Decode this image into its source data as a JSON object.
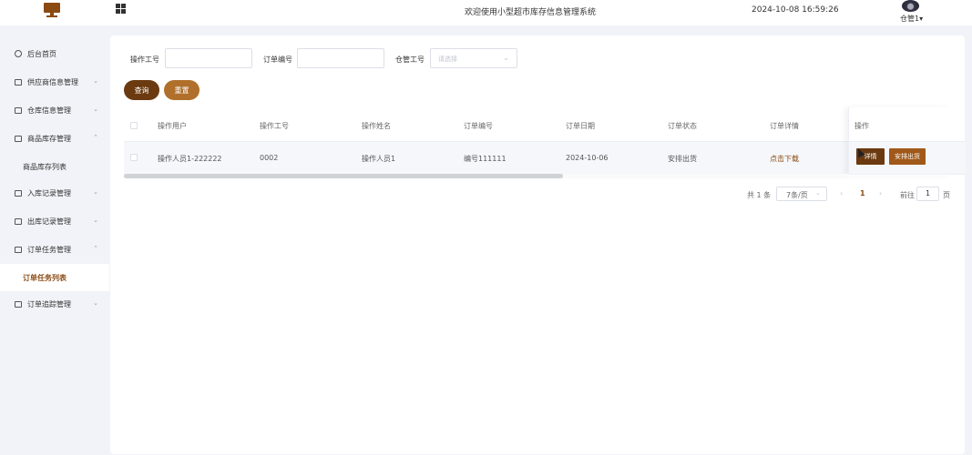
{
  "header": {
    "system_title": "欢迎使用小型超市库存信息管理系统",
    "datetime": "2024-10-08 16:59:26",
    "user_name": "仓管1",
    "user_caret": "▾"
  },
  "sidebar": {
    "items": [
      {
        "label": "后台首页",
        "icon": "clock-icon"
      },
      {
        "label": "供应商信息管理",
        "icon": "menu-icon",
        "arrow": "⌄"
      },
      {
        "label": "仓库信息管理",
        "icon": "menu-icon",
        "arrow": "⌄"
      },
      {
        "label": "商品库存管理",
        "icon": "menu-icon",
        "arrow": "⌃"
      },
      {
        "label": "商品库存列表"
      },
      {
        "label": "入库记录管理",
        "icon": "menu-icon",
        "arrow": "⌄"
      },
      {
        "label": "出库记录管理",
        "icon": "menu-icon",
        "arrow": "⌄"
      },
      {
        "label": "订单任务管理",
        "icon": "menu-icon",
        "arrow": "⌃"
      },
      {
        "label": "订单任务列表",
        "active": true
      },
      {
        "label": "订单追踪管理",
        "icon": "menu-icon",
        "arrow": "⌄"
      }
    ]
  },
  "filters": {
    "operator_id_label": "操作工号",
    "order_no_label": "订单编号",
    "warehouse_id_label": "仓管工号",
    "warehouse_placeholder": "请选择",
    "select_arrow": "⌄",
    "query_label": "查询",
    "reset_label": "重置"
  },
  "table": {
    "columns": [
      "操作用户",
      "操作工号",
      "操作姓名",
      "订单编号",
      "订单日期",
      "订单状态",
      "订单详情",
      "操作"
    ],
    "rows": [
      {
        "user": "操作人员1-222222",
        "op_id": "0002",
        "op_name": "操作人员1",
        "order_no": "编号111111",
        "order_date": "2024-10-06",
        "status": "安排出货",
        "detail": "点击下载",
        "action_detail": "详情",
        "action_ship": "安排出货"
      }
    ]
  },
  "pagination": {
    "total": "共 1 条",
    "page_size": "7条/页",
    "size_arrow": "⌄",
    "prev": "‹",
    "current": "1",
    "next": "›",
    "goto": "前往",
    "goto_value": "1",
    "page_suffix": "页"
  },
  "colors": {
    "brand": "#8a4a12",
    "query_button": "#6b3a10",
    "reset_button": "#b0702b"
  }
}
